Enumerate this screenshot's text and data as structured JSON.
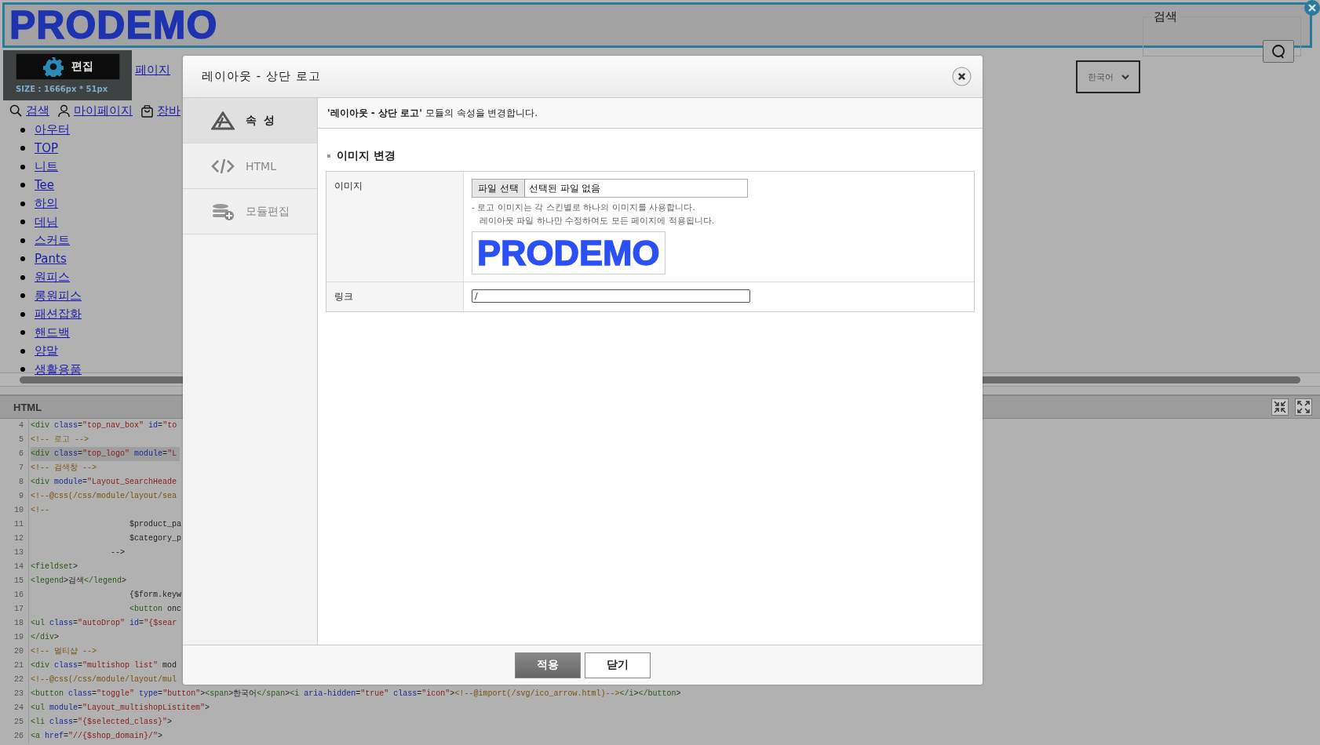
{
  "header": {
    "logo": "PRODEMO"
  },
  "nav": {
    "top_link": "페이지",
    "links": [
      "검색",
      "마이페이지",
      "장바"
    ]
  },
  "edit_overlay": {
    "button": "편집",
    "size": "SIZE : 1666px * 51px"
  },
  "search_box": {
    "legend": "검색"
  },
  "language_select": {
    "value": "한국어"
  },
  "categories": [
    "아우터",
    "TOP",
    "니트",
    "Tee",
    "하의",
    "데님",
    "스커트",
    "Pants",
    "원피스",
    "롱원피스",
    "패션잡화",
    "핸드백",
    "양말",
    "생활용품"
  ],
  "html_panel": {
    "title": "HTML",
    "lines": [
      {
        "number": "4",
        "code": "<div class=\"top_nav_box\" id=\"to"
      },
      {
        "number": "5",
        "code": "<!-- 로고 -->"
      },
      {
        "number": "6",
        "code": "<div class=\"top_logo\" module=\"L",
        "selected": true
      },
      {
        "number": "7",
        "code": "<!-- 검색창 -->"
      },
      {
        "number": "8",
        "code": "<div module=\"Layout_SearchHeade"
      },
      {
        "number": "9",
        "code": "<!--@css(/css/module/layout/sea"
      },
      {
        "number": "10",
        "code": "<!--"
      },
      {
        "number": "11",
        "code": "                     $product_pa"
      },
      {
        "number": "12",
        "code": "                     $category_p"
      },
      {
        "number": "13",
        "code": "                 -->"
      },
      {
        "number": "14",
        "code": "<fieldset>"
      },
      {
        "number": "15",
        "code": "<legend>검색</legend>"
      },
      {
        "number": "16",
        "code": "                     {$form.keyw"
      },
      {
        "number": "17",
        "code": "                     <button onc"
      },
      {
        "number": "18",
        "code": "<ul class=\"autoDrop\" id=\"{$sear"
      },
      {
        "number": "19",
        "code": "</div>"
      },
      {
        "number": "20",
        "code": "<!-- 멀티샵 -->"
      },
      {
        "number": "21",
        "code": "<div class=\"multishop list\" mod"
      },
      {
        "number": "22",
        "code": "<!--@css(/css/module/layout/mul"
      },
      {
        "number": "23",
        "code": "<button class=\"toggle\" type=\"button\"><span>한국어</span><i aria-hidden=\"true\" class=\"icon\"><!--@import(/svg/ico_arrow.html)--></i></button>"
      },
      {
        "number": "24",
        "code": "<ul module=\"Layout_multishopListitem\">"
      },
      {
        "number": "25",
        "code": "<li class=\"{$selected_class}\">"
      },
      {
        "number": "26",
        "code": "<a href=\"//{$shop_domain}/\">"
      }
    ]
  },
  "modal": {
    "title": "레이아웃 - 상단 로고",
    "tabs": [
      {
        "label": "속 성",
        "selected": true
      },
      {
        "label": "HTML",
        "selected": false
      },
      {
        "label": "모듈편집",
        "selected": false
      }
    ],
    "description": "**'레이아웃 - 상단 로고'** 모듈의 속성을 변경합니다.",
    "section_title": "이미지 변경",
    "fields": [
      {
        "kind": "image",
        "label": "이미지",
        "button": "파일 선택",
        "file_status": "선택된 파일 없음",
        "notes": [
          "- 로고 이미지는 각 스킨별로 하나의 이미지를 사용합니다.",
          "레이아웃 파일 하나만 수정하여도 모든 페이지에 적용됩니다."
        ],
        "preview": "PRODEMO"
      },
      {
        "kind": "text",
        "label": "링크",
        "value": "/"
      }
    ],
    "buttons": [
      {
        "label": "적용",
        "kind": "primary"
      },
      {
        "label": "닫기",
        "kind": "secondary"
      }
    ]
  }
}
